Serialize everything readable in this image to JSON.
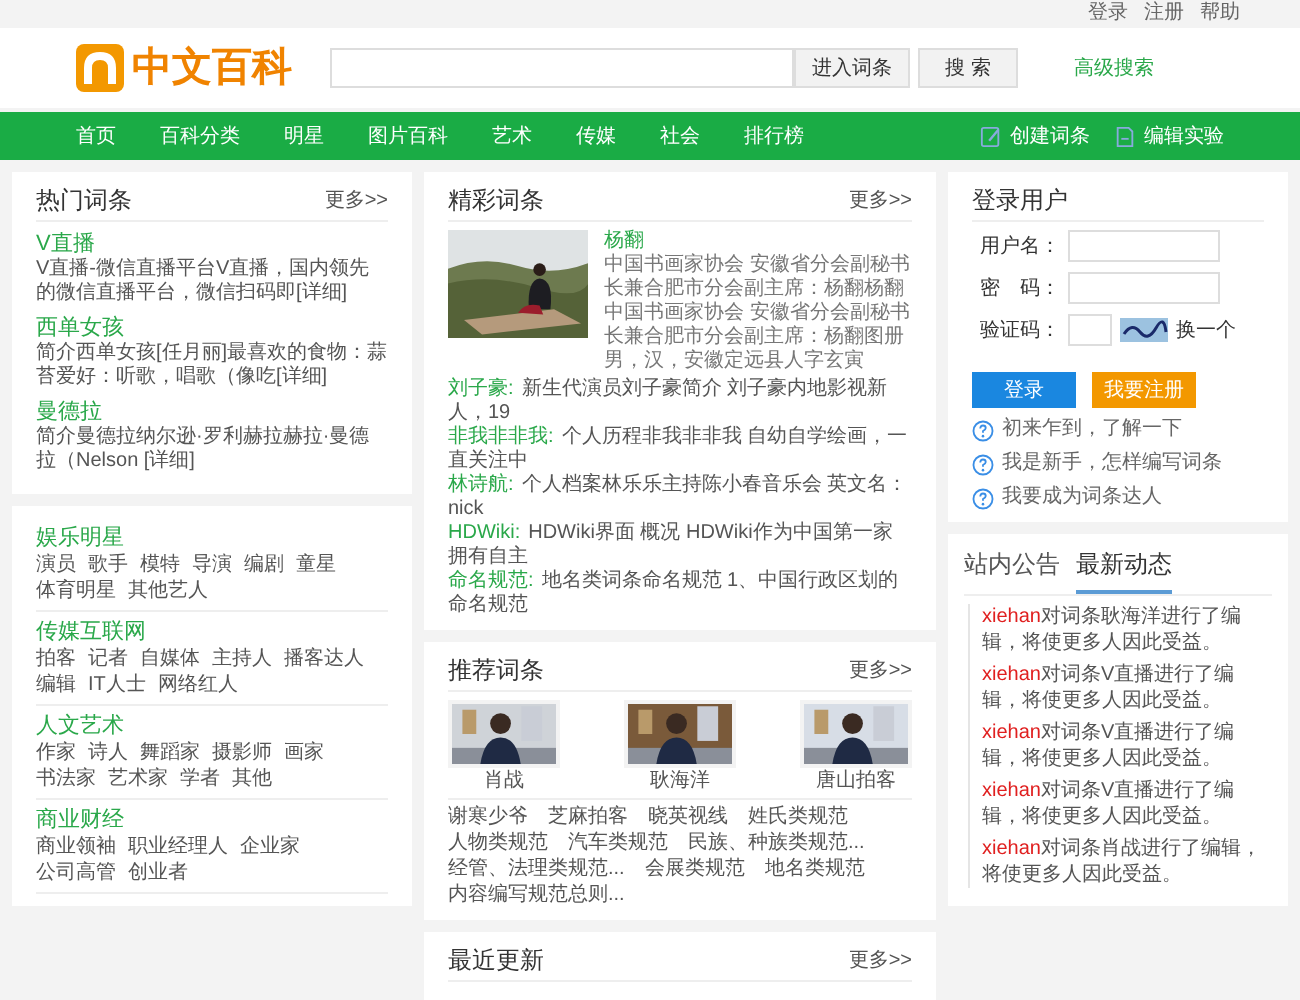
{
  "top_links": [
    "登录",
    "注册",
    "帮助"
  ],
  "header": {
    "logo": "中文百科",
    "enter_button": "进入词条",
    "search_button": "搜 索",
    "advanced": "高级搜索"
  },
  "nav": {
    "items": [
      "首页",
      "百科分类",
      "明星",
      "图片百科",
      "艺术",
      "传媒",
      "社会",
      "排行榜"
    ],
    "actions": [
      {
        "label": "创建词条",
        "kind": "create"
      },
      {
        "label": "编辑实验",
        "kind": "edit"
      }
    ]
  },
  "hot": {
    "title": "热门词条",
    "more": "更多>>",
    "entries": [
      {
        "title": "V直播",
        "summary": "V直播-微信直播平台V直播，国内领先的微信直播平台，微信扫码即[详细]"
      },
      {
        "title": "西单女孩",
        "summary": "简介西单女孩[任月丽]最喜欢的食物：蒜苔爱好：听歌，唱歌（像吃[详细]"
      },
      {
        "title": "曼德拉",
        "summary": "简介曼德拉纳尔逊·罗利赫拉赫拉·曼德拉（Nelson [详细]"
      }
    ]
  },
  "categories": [
    {
      "title": "娱乐明星",
      "tags": [
        "演员",
        "歌手",
        "模特",
        "导演",
        "编剧",
        "童星",
        "体育明星",
        "其他艺人"
      ]
    },
    {
      "title": "传媒互联网",
      "tags": [
        "拍客",
        "记者",
        "自媒体",
        "主持人",
        "播客达人",
        "编辑",
        "IT人士",
        "网络红人"
      ]
    },
    {
      "title": "人文艺术",
      "tags": [
        "作家",
        "诗人",
        "舞蹈家",
        "摄影师",
        "画家",
        "书法家",
        "艺术家",
        "学者",
        "其他"
      ]
    },
    {
      "title": "商业财经",
      "tags": [
        "商业领袖",
        "职业经理人",
        "企业家",
        "公司高管",
        "创业者"
      ]
    }
  ],
  "featured": {
    "title": "精彩词条",
    "more": "更多>>",
    "main": {
      "name": "杨翻",
      "summary": "中国书画家协会 安徽省分会副秘书长兼合肥市分会副主席：杨翻杨翻中国书画家协会 安徽省分会副秘书长兼合肥市分会副主席：杨翻图册男，汉，安徽定远县人字玄寅"
    },
    "lines": [
      {
        "term": "刘子豪:",
        "text": "新生代演员刘子豪简介 刘子豪内地影视新人，19"
      },
      {
        "term": "非我非非我:",
        "text": "个人历程非我非非我 自幼自学绘画，一直关注中"
      },
      {
        "term": "林诗航:",
        "text": "个人档案林乐乐主持陈小春音乐会 英文名：nick"
      },
      {
        "term": "HDWiki:",
        "text": "HDWiki界面 概况 HDWiki作为中国第一家拥有自主"
      },
      {
        "term": "命名规范:",
        "text": "地名类词条命名规范 1、中国行政区划的命名规范"
      }
    ]
  },
  "recommended": {
    "title": "推荐词条",
    "more": "更多>>",
    "people": [
      {
        "name": "肖战"
      },
      {
        "name": "耿海洋"
      },
      {
        "name": "唐山拍客"
      }
    ],
    "links": [
      "谢寒少爷",
      "芝麻拍客",
      "晓英视线",
      "姓氏类规范",
      "人物类规范",
      "汽车类规范",
      "民族、种族类规范...",
      "经管、法理类规范...",
      "会展类规范",
      "地名类规范",
      "内容编写规范总则..."
    ]
  },
  "recent": {
    "title": "最近更新",
    "more": "更多>>"
  },
  "login": {
    "title": "登录用户",
    "fields": [
      {
        "label": "用户名："
      },
      {
        "label": "密　码："
      }
    ],
    "captcha_label": "验证码：",
    "refresh": "换一个",
    "login_button": "登录",
    "register_button": "我要注册",
    "help": [
      "初来乍到，了解一下",
      "我是新手，怎样编写词条",
      "我要成为词条达人"
    ]
  },
  "news": {
    "tabs": [
      {
        "label": "站内公告",
        "selected": false
      },
      {
        "label": "最新动态",
        "selected": true
      }
    ],
    "entries": [
      {
        "user": "xiehan",
        "text": "对词条耿海洋进行了编辑，将使更多人因此受益。"
      },
      {
        "user": "xiehan",
        "text": "对词条V直播进行了编辑，将使更多人因此受益。"
      },
      {
        "user": "xiehan",
        "text": "对词条V直播进行了编辑，将使更多人因此受益。"
      },
      {
        "user": "xiehan",
        "text": "对词条V直播进行了编辑，将使更多人因此受益。"
      },
      {
        "user": "xiehan",
        "text": "对词条肖战进行了编辑，将使更多人因此受益。"
      }
    ]
  }
}
